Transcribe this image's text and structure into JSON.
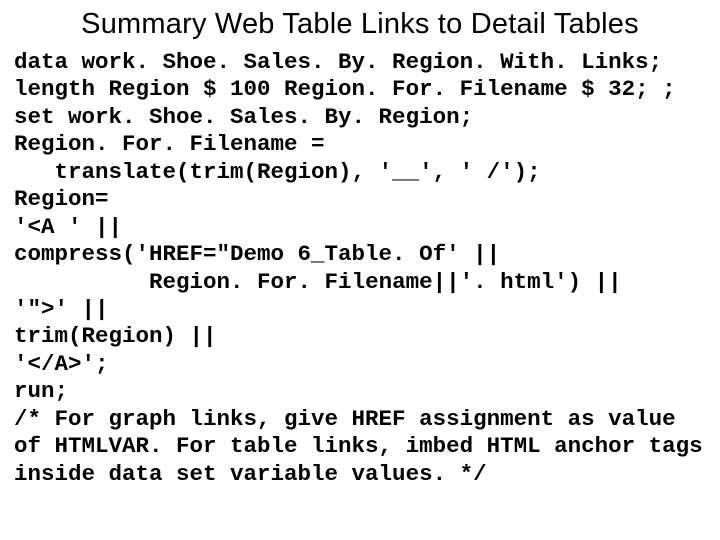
{
  "title": "Summary Web Table Links to Detail Tables",
  "code_lines": [
    "data work. Shoe. Sales. By. Region. With. Links;",
    "length Region $ 100 Region. For. Filename $ 32; ;",
    "set work. Shoe. Sales. By. Region;",
    "Region. For. Filename =",
    "   translate(trim(Region), '__', ' /');",
    "Region=",
    "'<A ' ||",
    "compress('HREF=\"Demo 6_Table. Of' ||",
    "          Region. For. Filename||'. html') ||",
    "'\">' ||",
    "trim(Region) ||",
    "'</A>';",
    "run;",
    "/* For graph links, give HREF assignment as value of HTMLVAR. For table links, imbed HTML anchor tags inside data set variable values. */"
  ]
}
